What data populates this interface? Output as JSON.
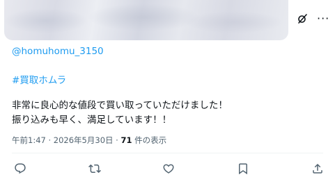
{
  "tweet": {
    "mention": "@homuhomu_3150",
    "hashtag": "#買取ホムラ",
    "body_line_1": "非常に良心的な値段で買い取っていただけました！",
    "body_line_2": "振り込みも早く、満足しています！！",
    "timestamp": "午前1:47 · 2026年5月30日 · ",
    "view_count": "71",
    "view_suffix": " 件の表示"
  },
  "top_actions": {
    "grok_icon": "grok-slash-icon",
    "more_label": "···"
  },
  "actions": [
    "reply-icon",
    "retweet-icon",
    "like-icon",
    "bookmark-icon",
    "share-icon"
  ],
  "colors": {
    "link": "#1d9bf0",
    "text": "#0f1419",
    "muted": "#536471"
  }
}
